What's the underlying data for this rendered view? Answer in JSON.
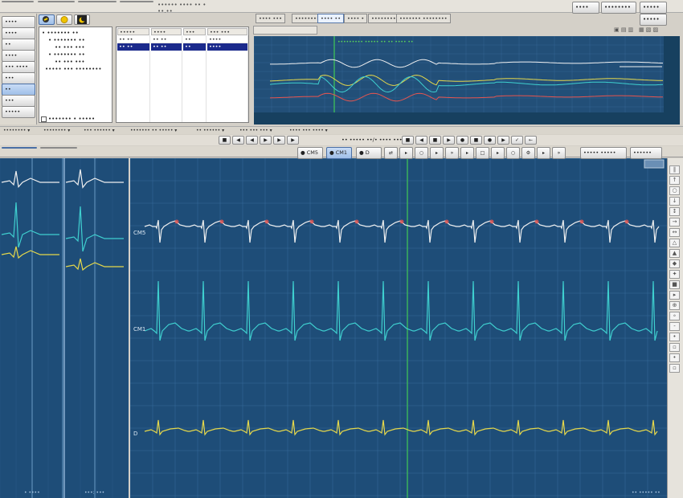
{
  "toolbar": {
    "icons": [
      "zoom-icon",
      "sun-icon",
      "moon-icon"
    ],
    "title_field": "•••••• •••• •• • ••.••"
  },
  "side_nav": {
    "items": [
      "••••",
      "••••",
      "••",
      "••••",
      "••• ••••",
      "•••",
      "••",
      "•••",
      "•••••"
    ]
  },
  "tree": {
    "rows": [
      "• ••••••• ••",
      "• ••••••• ••",
      "•• ••• •••",
      "• ••••••• ••",
      "•• ••• •••",
      "••••• ••• ••••••••"
    ],
    "checkbox_label": "••••••• • •••••"
  },
  "table": {
    "headers": [
      "•••••",
      "••••",
      "•••",
      "••• •••"
    ],
    "rows": [
      [
        "•• ••",
        "•• ••",
        "••",
        "••••"
      ],
      [
        "•• ••",
        "•• ••",
        "••",
        "••••"
      ]
    ]
  },
  "top_tabs": [
    "•••• •••",
    "•••••••••",
    "•••• ••",
    "•••• •",
    "••••••••••",
    "••••••• ••••••••"
  ],
  "right_buttons": [
    "••••",
    "••••••••",
    "•••••"
  ],
  "trend_title": "••••••••• ••••• •• •• •••• ••",
  "bottom_tabs": [
    "••••••••",
    "••••••••",
    "••• ••••••",
    "••••••• •• •••••",
    "•• ••••••",
    "••• ••• •••",
    "•••• ••• ••••"
  ],
  "lead_buttons": [
    "CM5",
    "CM1",
    "D"
  ],
  "lead_labels": [
    "CM5",
    "CM1",
    "D"
  ],
  "speed_text": "•• ••••• ••/• •••• •••",
  "ecg_right_buttons": [
    "••••• •••••",
    "••••••"
  ],
  "sidebar_labels": [
    "• ••••",
    "•••: •••"
  ],
  "status": "•• ••••• ••",
  "colors": {
    "trace_white": "#f0f0f0",
    "trace_cyan": "#3fd0d0",
    "trace_yellow": "#e6d84a",
    "trace_red": "#e8554f",
    "marker_green": "#3ab25c",
    "grid": "#3f72a5",
    "bg": "#1e4d78"
  }
}
